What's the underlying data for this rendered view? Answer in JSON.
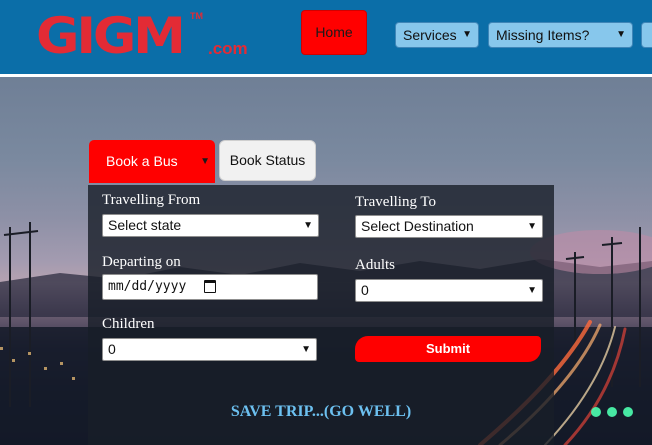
{
  "header": {
    "logo_text": "GIGM",
    "logo_tm": "TM",
    "logo_domain": ".com",
    "nav": {
      "home_label": "Home",
      "services_label": "Services",
      "missing_items_label": "Missing Items?"
    }
  },
  "booking": {
    "tab_book_label": "Book a Bus",
    "tab_status_label": "Book Status",
    "travelling_from": {
      "label": "Travelling From",
      "value": "Select state"
    },
    "travelling_to": {
      "label": "Travelling To",
      "value": "Select Destination"
    },
    "departing_on": {
      "label": "Departing on",
      "value": "mm/dd/yyyy"
    },
    "adults": {
      "label": "Adults",
      "value": "0"
    },
    "children": {
      "label": "Children",
      "value": "0"
    },
    "submit_label": "Submit",
    "tagline": "SAVE TRIP...(GO WELL)"
  },
  "icons": {
    "dropdown": "chevron-down-icon",
    "calendar": "calendar-icon"
  },
  "colors": {
    "header_bg": "#0b6ea8",
    "brand_red": "#e32b35",
    "accent_red": "#ff0000",
    "nav_select_bg": "#87c7ec",
    "tagline": "#6cc0f0"
  }
}
